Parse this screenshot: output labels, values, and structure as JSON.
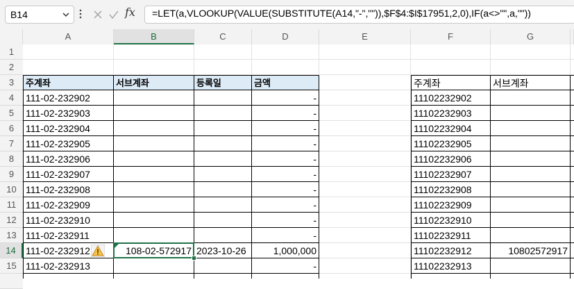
{
  "name_box": "B14",
  "formula": "=LET(a,VLOOKUP(VALUE(SUBSTITUTE(A14,\"-\",\"\")),$F$4:$I$17951,2,0),IF(a<>\"\",a,\"\"))",
  "fx_label": "fx",
  "columns": [
    "A",
    "B",
    "C",
    "D",
    "E",
    "F",
    "G"
  ],
  "rows": [
    "1",
    "2",
    "3",
    "4",
    "5",
    "6",
    "7",
    "8",
    "9",
    "10",
    "11",
    "12",
    "13",
    "14",
    "15"
  ],
  "left_table": {
    "headers": [
      "주계좌",
      "서브계좌",
      "등록일",
      "금액"
    ],
    "rows": [
      [
        "111-02-232902",
        "",
        "",
        "-"
      ],
      [
        "111-02-232903",
        "",
        "",
        "-"
      ],
      [
        "111-02-232904",
        "",
        "",
        "-"
      ],
      [
        "111-02-232905",
        "",
        "",
        "-"
      ],
      [
        "111-02-232906",
        "",
        "",
        "-"
      ],
      [
        "111-02-232907",
        "",
        "",
        "-"
      ],
      [
        "111-02-232908",
        "",
        "",
        "-"
      ],
      [
        "111-02-232909",
        "",
        "",
        "-"
      ],
      [
        "111-02-232910",
        "",
        "",
        "-"
      ],
      [
        "111-02-232911",
        "",
        "",
        "-"
      ],
      [
        "111-02-232912",
        "108-02-572917",
        "2023-10-26",
        "1,000,000"
      ],
      [
        "111-02-232913",
        "",
        "",
        "-"
      ]
    ]
  },
  "right_table": {
    "headers": [
      "주계좌",
      "서브계좌"
    ],
    "rows": [
      [
        "11102232902",
        ""
      ],
      [
        "11102232903",
        ""
      ],
      [
        "11102232904",
        ""
      ],
      [
        "11102232905",
        ""
      ],
      [
        "11102232906",
        ""
      ],
      [
        "11102232907",
        ""
      ],
      [
        "11102232908",
        ""
      ],
      [
        "11102232909",
        ""
      ],
      [
        "11102232910",
        ""
      ],
      [
        "11102232911",
        ""
      ],
      [
        "11102232912",
        "10802572917"
      ],
      [
        "11102232913",
        ""
      ]
    ]
  }
}
